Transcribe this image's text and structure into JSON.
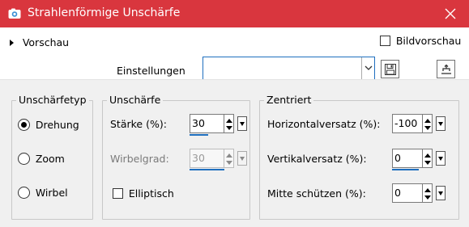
{
  "window": {
    "title": "Strahlenförmige Unschärfe",
    "icon": "camera-icon",
    "close_icon": "close-icon"
  },
  "preview": {
    "label": "Vorschau",
    "expanded": false
  },
  "image_preview": {
    "label": "Bildvorschau",
    "checked": false
  },
  "settings": {
    "label": "Einstellungen",
    "value": "",
    "save_icon": "save-icon",
    "reset_icon": "reset-icon"
  },
  "blur_type": {
    "title": "Unschärfetyp",
    "options": [
      {
        "label": "Drehung",
        "checked": true
      },
      {
        "label": "Zoom",
        "checked": false
      },
      {
        "label": "Wirbel",
        "checked": false
      }
    ]
  },
  "blur": {
    "title": "Unschärfe",
    "strength": {
      "label": "Stärke (%):",
      "value": "30"
    },
    "twist": {
      "label": "Wirbelgrad:",
      "value": "30",
      "disabled": true
    },
    "elliptical": {
      "label": "Elliptisch",
      "checked": false
    }
  },
  "centered": {
    "title": "Zentriert",
    "horizontal": {
      "label": "Horizontalversatz (%):",
      "value": "-100"
    },
    "vertical": {
      "label": "Vertikalversatz (%):",
      "value": "0"
    },
    "protect_center": {
      "label": "Mitte schützen (%):",
      "value": "0"
    }
  },
  "colors": {
    "titlebar": "#d9363e",
    "accent": "#1f6fbf",
    "panel": "#f0f0f0"
  }
}
